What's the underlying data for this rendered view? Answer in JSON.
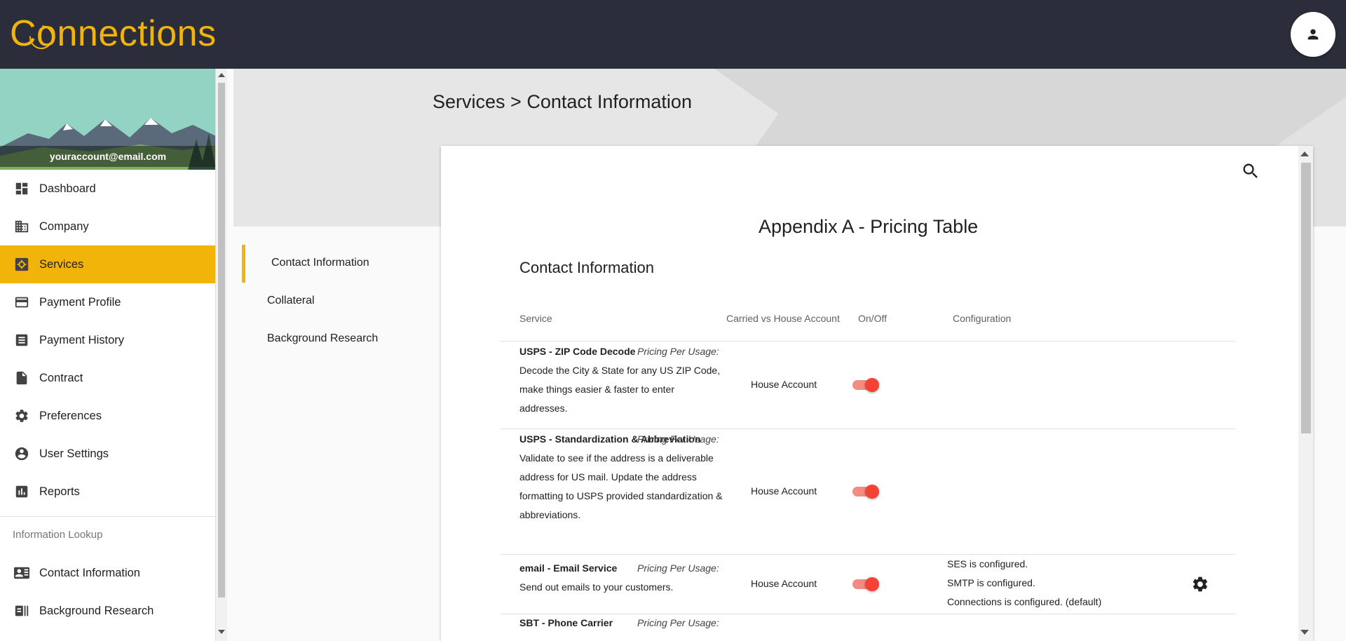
{
  "app": {
    "logo_text": "Connections",
    "brand_color": "#f3b409",
    "header_bg": "#2b2e3a"
  },
  "header": {
    "account_icon": "person-icon"
  },
  "sidebar": {
    "email": "youraccount@email.com",
    "items": [
      {
        "label": "Dashboard",
        "icon": "dashboard-icon"
      },
      {
        "label": "Company",
        "icon": "building-icon"
      },
      {
        "label": "Services",
        "icon": "services-icon",
        "active": true
      },
      {
        "label": "Payment Profile",
        "icon": "credit-card-icon"
      },
      {
        "label": "Payment History",
        "icon": "receipt-icon"
      },
      {
        "label": "Contract",
        "icon": "document-icon"
      },
      {
        "label": "Preferences",
        "icon": "gear-icon"
      },
      {
        "label": "User Settings",
        "icon": "account-circle-icon"
      },
      {
        "label": "Reports",
        "icon": "bar-chart-icon"
      }
    ],
    "section_label": "Information Lookup",
    "lookup_items": [
      {
        "label": "Contact Information",
        "icon": "contact-card-icon"
      },
      {
        "label": "Background Research",
        "icon": "barcode-icon"
      }
    ]
  },
  "breadcrumb": {
    "parent": "Services",
    "separator": ">",
    "current": "Contact Information"
  },
  "subnav": {
    "items": [
      "Contact Information",
      "Collateral",
      "Background Research"
    ],
    "active_index": 0
  },
  "card": {
    "title": "Appendix A - Pricing Table",
    "section_title": "Contact Information",
    "search_icon": "search-icon",
    "columns": [
      "Service",
      "Carried vs House Account",
      "On/Off",
      "Configuration"
    ],
    "rows": [
      {
        "name": "USPS - ZIP Code Decode",
        "pricing": "Pricing Per Usage:",
        "description": "Decode the City & State for any US ZIP Code, make things easier & faster to enter addresses.",
        "account": "House Account",
        "enabled": true,
        "config": []
      },
      {
        "name": "USPS - Standardization & Abbreviation",
        "pricing": "Pricing Per Usage:",
        "description": "Validate to see if the address is a deliverable address for US mail. Update the address formatting to USPS provided standardization & abbreviations.",
        "account": "House Account",
        "enabled": true,
        "config": []
      },
      {
        "name": "email - Email Service",
        "pricing": "Pricing Per Usage:",
        "description": "Send out emails to your customers.",
        "account": "House Account",
        "enabled": true,
        "config": [
          "SES is configured.",
          "SMTP is configured.",
          "Connections is configured. (default)"
        ],
        "config_icon": "gear-icon"
      },
      {
        "name": "SBT - Phone Carrier",
        "pricing": "Pricing Per Usage:",
        "account": "",
        "enabled": null,
        "config": []
      }
    ],
    "toggle_on_color": "#f44336"
  }
}
